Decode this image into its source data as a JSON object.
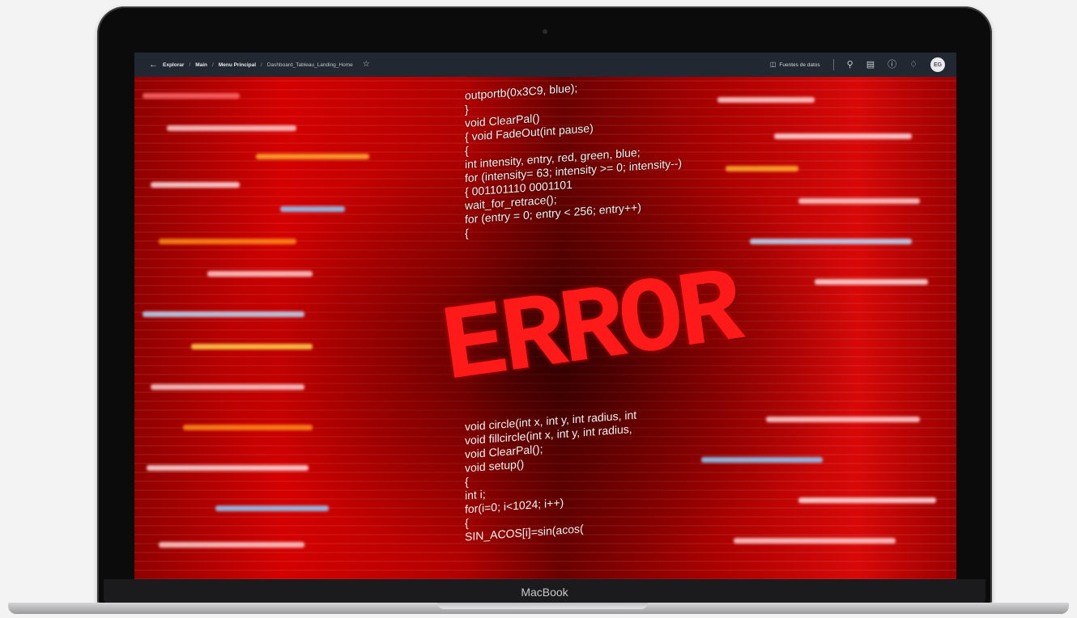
{
  "header": {
    "back_icon": "arrow-left-icon",
    "breadcrumb": [
      {
        "label": "Explorar",
        "strong": true
      },
      {
        "label": "Main",
        "strong": true
      },
      {
        "label": "Menu Principal",
        "strong": true
      },
      {
        "label": "Dashboard_Tableau_Landing_Home",
        "strong": false
      }
    ],
    "separator": "/",
    "favorite_icon": "star-icon",
    "data_sources_label": "Fuentes de datos",
    "data_sources_icon": "database-icon",
    "search_icon": "search-icon",
    "doc_icon": "document-icon",
    "help_icon": "help-icon",
    "bell_icon": "bell-icon",
    "avatar_initials": "EG"
  },
  "content": {
    "error_text": "ERROR",
    "code_upper": [
      "outportb(0x3C9, blue);",
      "}",
      "void ClearPal()",
      "{ void FadeOut(int pause)",
      "{",
      "int intensity, entry, red, green, blue;",
      "for (intensity= 63; intensity >= 0; intensity--)",
      "{ 001101110 0001101",
      "wait_for_retrace();",
      "for (entry = 0; entry < 256; entry++)",
      "{"
    ],
    "code_lower": [
      "void circle(int x, int y, int radius, int",
      "void fillcircle(int x, int y, int radius,",
      "void ClearPal();",
      "void setup()",
      "{",
      "int i;",
      "for(i=0; i<1024; i++)",
      "{",
      "SIN_ACOS[i]=sin(acos("
    ]
  },
  "device": {
    "brand": "MacBook"
  },
  "colors": {
    "topbar": "#222831",
    "error_red": "#ff1a1a",
    "background_red": "#d40000"
  }
}
